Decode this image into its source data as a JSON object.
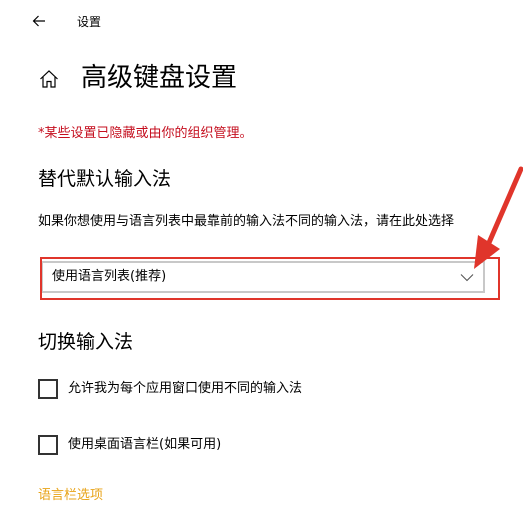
{
  "window": {
    "title": "设置"
  },
  "page": {
    "title": "高级键盘设置",
    "managed_notice": "*某些设置已隐藏或由你的组织管理。"
  },
  "override_section": {
    "heading": "替代默认输入法",
    "description": "如果你想使用与语言列表中最靠前的输入法不同的输入法，请在此处选择",
    "dropdown": {
      "selected": "使用语言列表(推荐)"
    }
  },
  "switch_section": {
    "heading": "切换输入法",
    "options": [
      {
        "label": "允许我为每个应用窗口使用不同的输入法",
        "checked": false
      },
      {
        "label": "使用桌面语言栏(如果可用)",
        "checked": false
      }
    ],
    "language_bar_link": "语言栏选项"
  },
  "colors": {
    "notice": "#c50f1f",
    "link": "#e8a317",
    "annotation": "#e0352b"
  },
  "icons": {
    "back": "back-arrow-icon",
    "home": "home-icon",
    "dropdown": "chevron-down-icon"
  }
}
